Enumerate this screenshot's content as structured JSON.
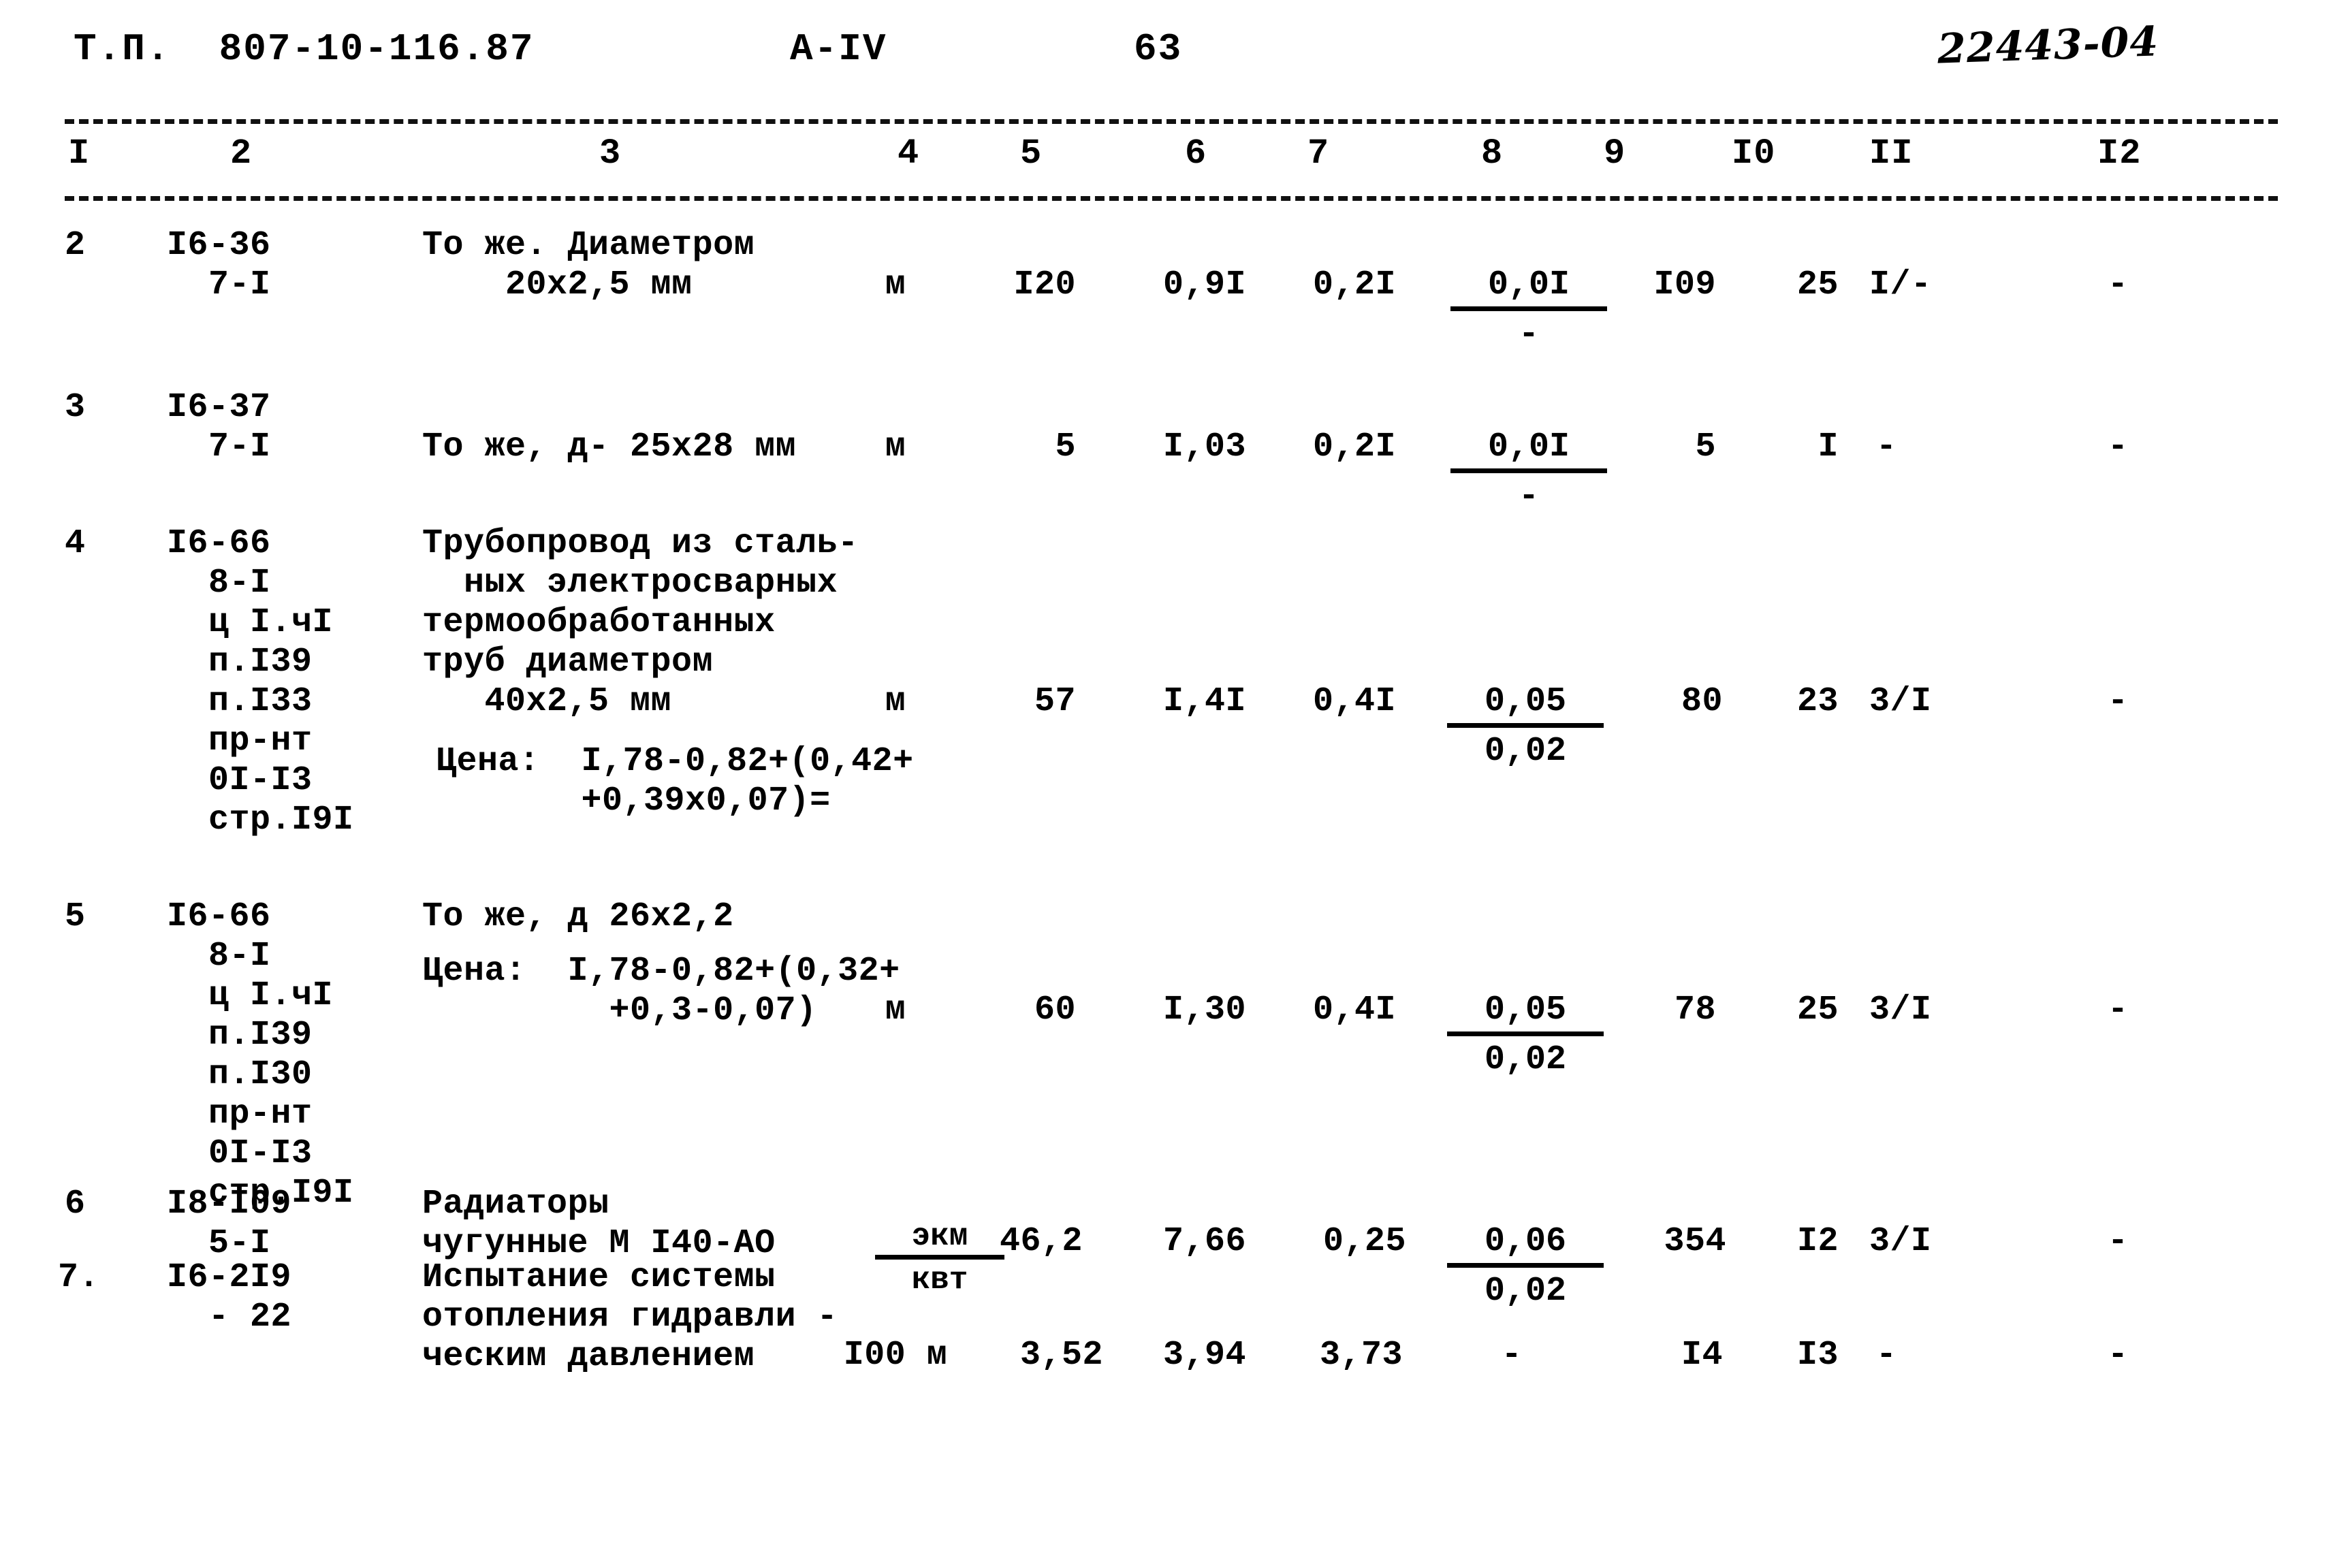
{
  "header": {
    "doc_code": "Т.П.  807-10-116.87",
    "part": "А-IV",
    "page_number": "63",
    "archive_stamp": "22443-04"
  },
  "table": {
    "column_numbers": [
      "I",
      "2",
      "3",
      "4",
      "5",
      "6",
      "7",
      "8",
      "9",
      "I0",
      "II",
      "I2"
    ],
    "rows": [
      {
        "num": "2",
        "code": "I6-36\n  7-I",
        "description": "То же. Диаметром\n    20х2,5 мм",
        "unit": "м",
        "c5": "I20",
        "c6": "0,9I",
        "c7": "0,2I",
        "c8_numer": "0,0I",
        "c8_denom": "-",
        "c9": "I09",
        "c10": "25",
        "c11": "I/-",
        "c12": "-"
      },
      {
        "num": "3",
        "code": "I6-37\n  7-I",
        "description": "То же, д- 25х28 мм",
        "unit": "м",
        "c5": "5",
        "c6": "I,03",
        "c7": "0,2I",
        "c8_numer": "0,0I",
        "c8_denom": "-",
        "c9": "5",
        "c10": "I",
        "c11": "-",
        "c12": "-"
      },
      {
        "num": "4",
        "code": "I6-66\n  8-I\n  ц I.чI\n  п.I39\n  п.I33\n  пр-нт\n  0I-I3\n  стр.I9I",
        "description": "Трубопровод из сталь-\n  ных электросварных\nтермообработанных\nтруб диаметром\n   40х2,5 мм",
        "price_note": "Цена:  I,78-0,82+(0,42+\n       +0,39х0,07)=",
        "unit": "м",
        "c5": "57",
        "c6": "I,4I",
        "c7": "0,4I",
        "c8_numer": "0,05",
        "c8_denom": "0,02",
        "c9": "80",
        "c10": "23",
        "c11": "3/I",
        "c12": "-"
      },
      {
        "num": "5",
        "code": "I6-66\n  8-I\n  ц I.чI\n  п.I39\n  п.I30\n  пр-нт\n  0I-I3\n  стр.I9I",
        "description": "То же, д 26х2,2",
        "price_note": "Цена:  I,78-0,82+(0,32+\n         +0,3-0,07)",
        "unit": "м",
        "c5": "60",
        "c6": "I,30",
        "c7": "0,4I",
        "c8_numer": "0,05",
        "c8_denom": "0,02",
        "c9": "78",
        "c10": "25",
        "c11": "3/I",
        "c12": "-"
      },
      {
        "num": "6",
        "code": "I8-I09\n  5-I",
        "description": "Радиаторы\nчугунные М I40-АО",
        "unit_numer": "экм",
        "unit_denom": "квт",
        "c5": "46,2",
        "c6": "7,66",
        "c7": "0,25",
        "c8_numer": "0,06",
        "c8_denom": "0,02",
        "c9": "354",
        "c10": "I2",
        "c11": "3/I",
        "c12": "-"
      },
      {
        "num": "7.",
        "code": "I6-2I9\n  - 22",
        "description": "Испытание системы\nотопления гидравли -\nческим давлением",
        "unit": "I00 м",
        "c5": "3,52",
        "c6": "3,94",
        "c7": "3,73",
        "c8_plain": "-",
        "c9": "I4",
        "c10": "I3",
        "c11": "-",
        "c12": "-"
      }
    ]
  }
}
